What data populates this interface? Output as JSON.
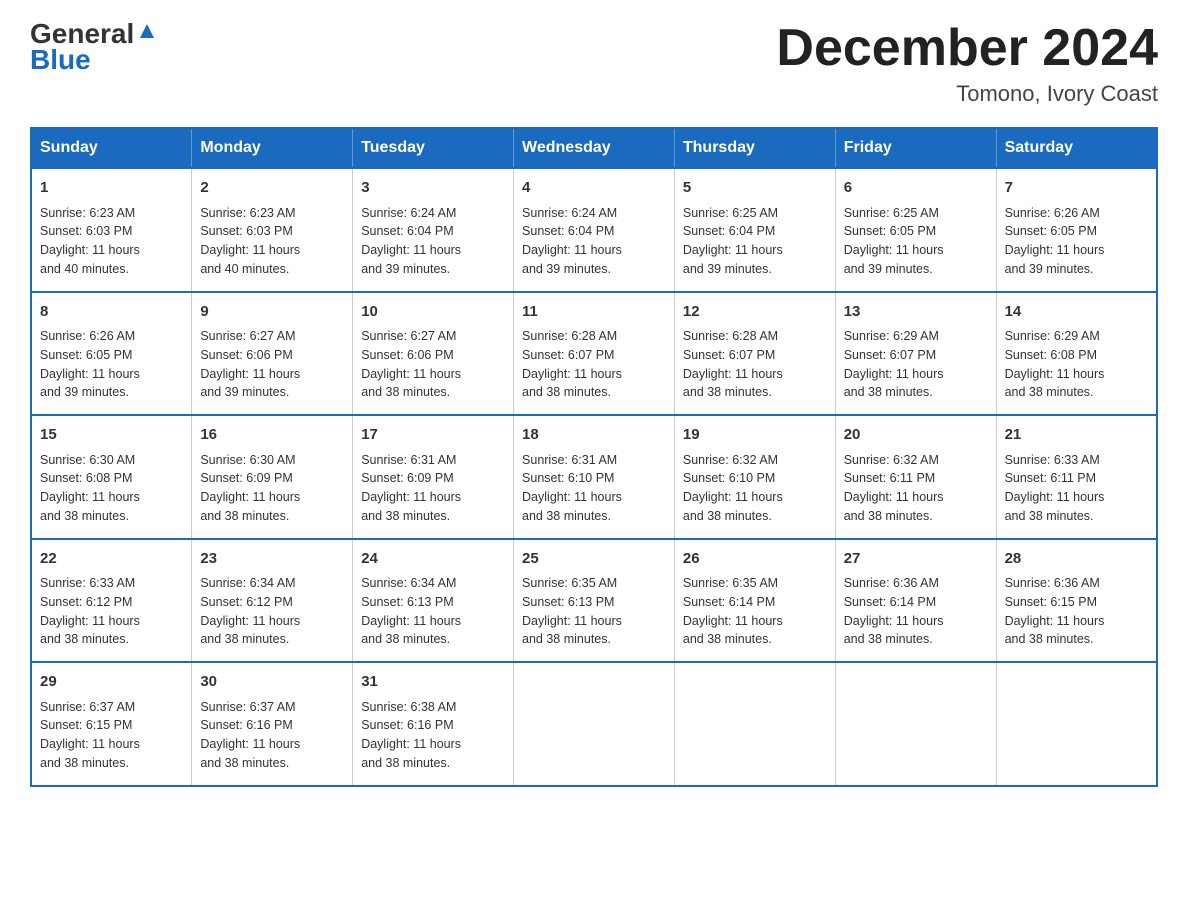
{
  "logo": {
    "line1": "General",
    "line2": "Blue"
  },
  "title": {
    "month_year": "December 2024",
    "location": "Tomono, Ivory Coast"
  },
  "weekdays": [
    "Sunday",
    "Monday",
    "Tuesday",
    "Wednesday",
    "Thursday",
    "Friday",
    "Saturday"
  ],
  "weeks": [
    [
      {
        "day": "1",
        "info": "Sunrise: 6:23 AM\nSunset: 6:03 PM\nDaylight: 11 hours\nand 40 minutes."
      },
      {
        "day": "2",
        "info": "Sunrise: 6:23 AM\nSunset: 6:03 PM\nDaylight: 11 hours\nand 40 minutes."
      },
      {
        "day": "3",
        "info": "Sunrise: 6:24 AM\nSunset: 6:04 PM\nDaylight: 11 hours\nand 39 minutes."
      },
      {
        "day": "4",
        "info": "Sunrise: 6:24 AM\nSunset: 6:04 PM\nDaylight: 11 hours\nand 39 minutes."
      },
      {
        "day": "5",
        "info": "Sunrise: 6:25 AM\nSunset: 6:04 PM\nDaylight: 11 hours\nand 39 minutes."
      },
      {
        "day": "6",
        "info": "Sunrise: 6:25 AM\nSunset: 6:05 PM\nDaylight: 11 hours\nand 39 minutes."
      },
      {
        "day": "7",
        "info": "Sunrise: 6:26 AM\nSunset: 6:05 PM\nDaylight: 11 hours\nand 39 minutes."
      }
    ],
    [
      {
        "day": "8",
        "info": "Sunrise: 6:26 AM\nSunset: 6:05 PM\nDaylight: 11 hours\nand 39 minutes."
      },
      {
        "day": "9",
        "info": "Sunrise: 6:27 AM\nSunset: 6:06 PM\nDaylight: 11 hours\nand 39 minutes."
      },
      {
        "day": "10",
        "info": "Sunrise: 6:27 AM\nSunset: 6:06 PM\nDaylight: 11 hours\nand 38 minutes."
      },
      {
        "day": "11",
        "info": "Sunrise: 6:28 AM\nSunset: 6:07 PM\nDaylight: 11 hours\nand 38 minutes."
      },
      {
        "day": "12",
        "info": "Sunrise: 6:28 AM\nSunset: 6:07 PM\nDaylight: 11 hours\nand 38 minutes."
      },
      {
        "day": "13",
        "info": "Sunrise: 6:29 AM\nSunset: 6:07 PM\nDaylight: 11 hours\nand 38 minutes."
      },
      {
        "day": "14",
        "info": "Sunrise: 6:29 AM\nSunset: 6:08 PM\nDaylight: 11 hours\nand 38 minutes."
      }
    ],
    [
      {
        "day": "15",
        "info": "Sunrise: 6:30 AM\nSunset: 6:08 PM\nDaylight: 11 hours\nand 38 minutes."
      },
      {
        "day": "16",
        "info": "Sunrise: 6:30 AM\nSunset: 6:09 PM\nDaylight: 11 hours\nand 38 minutes."
      },
      {
        "day": "17",
        "info": "Sunrise: 6:31 AM\nSunset: 6:09 PM\nDaylight: 11 hours\nand 38 minutes."
      },
      {
        "day": "18",
        "info": "Sunrise: 6:31 AM\nSunset: 6:10 PM\nDaylight: 11 hours\nand 38 minutes."
      },
      {
        "day": "19",
        "info": "Sunrise: 6:32 AM\nSunset: 6:10 PM\nDaylight: 11 hours\nand 38 minutes."
      },
      {
        "day": "20",
        "info": "Sunrise: 6:32 AM\nSunset: 6:11 PM\nDaylight: 11 hours\nand 38 minutes."
      },
      {
        "day": "21",
        "info": "Sunrise: 6:33 AM\nSunset: 6:11 PM\nDaylight: 11 hours\nand 38 minutes."
      }
    ],
    [
      {
        "day": "22",
        "info": "Sunrise: 6:33 AM\nSunset: 6:12 PM\nDaylight: 11 hours\nand 38 minutes."
      },
      {
        "day": "23",
        "info": "Sunrise: 6:34 AM\nSunset: 6:12 PM\nDaylight: 11 hours\nand 38 minutes."
      },
      {
        "day": "24",
        "info": "Sunrise: 6:34 AM\nSunset: 6:13 PM\nDaylight: 11 hours\nand 38 minutes."
      },
      {
        "day": "25",
        "info": "Sunrise: 6:35 AM\nSunset: 6:13 PM\nDaylight: 11 hours\nand 38 minutes."
      },
      {
        "day": "26",
        "info": "Sunrise: 6:35 AM\nSunset: 6:14 PM\nDaylight: 11 hours\nand 38 minutes."
      },
      {
        "day": "27",
        "info": "Sunrise: 6:36 AM\nSunset: 6:14 PM\nDaylight: 11 hours\nand 38 minutes."
      },
      {
        "day": "28",
        "info": "Sunrise: 6:36 AM\nSunset: 6:15 PM\nDaylight: 11 hours\nand 38 minutes."
      }
    ],
    [
      {
        "day": "29",
        "info": "Sunrise: 6:37 AM\nSunset: 6:15 PM\nDaylight: 11 hours\nand 38 minutes."
      },
      {
        "day": "30",
        "info": "Sunrise: 6:37 AM\nSunset: 6:16 PM\nDaylight: 11 hours\nand 38 minutes."
      },
      {
        "day": "31",
        "info": "Sunrise: 6:38 AM\nSunset: 6:16 PM\nDaylight: 11 hours\nand 38 minutes."
      },
      {
        "day": "",
        "info": ""
      },
      {
        "day": "",
        "info": ""
      },
      {
        "day": "",
        "info": ""
      },
      {
        "day": "",
        "info": ""
      }
    ]
  ]
}
